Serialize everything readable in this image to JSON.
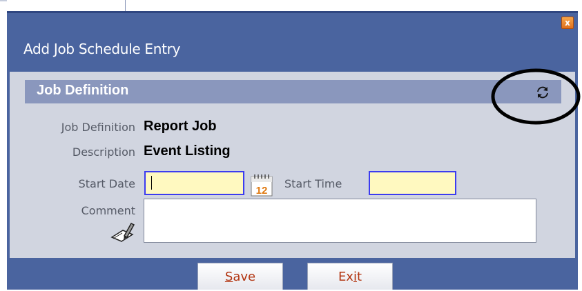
{
  "dialog": {
    "title": "Add Job Schedule Entry",
    "close_label": "x"
  },
  "section": {
    "title": "Job Definition",
    "refresh_icon": "refresh-icon"
  },
  "fields": {
    "job_definition_label": "Job Definition",
    "job_definition_value": "Report Job",
    "description_label": "Description",
    "description_value": "Event Listing",
    "start_date_label": "Start Date",
    "start_date_value": "",
    "start_time_label": "Start Time",
    "start_time_value": "",
    "comment_label": "Comment",
    "comment_value": "",
    "calendar_icon_number": "12"
  },
  "buttons": {
    "save_label": "Save",
    "exit_label": "Exit"
  },
  "colors": {
    "frame": "#4a649f",
    "body": "#d1d5e0",
    "section_header": "#8a97bd",
    "input_bg": "#fff9c0",
    "input_border": "#3c3cf0",
    "button_text": "#b23410",
    "close_button": "#e8822a"
  }
}
